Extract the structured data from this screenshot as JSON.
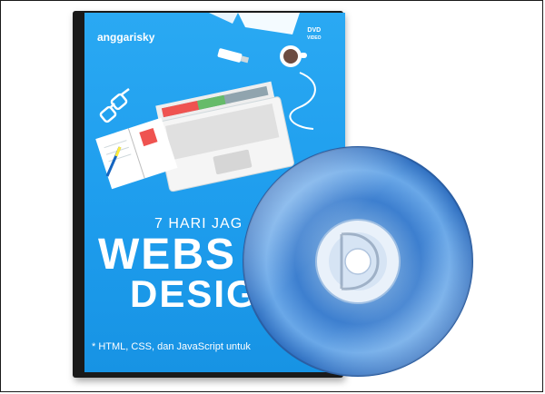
{
  "product": {
    "brand": "anggarisky",
    "dvd_logo_top": "DVD",
    "dvd_logo_bottom": "VIDEO",
    "subtitle": "7 HARI JAG",
    "title_line1": "WEBS",
    "title_line2": "DESIG",
    "tagline": "* HTML, CSS, dan JavaScript untuk",
    "illustration_icons": [
      "laptop-icon",
      "glasses-icon",
      "notebook-icon",
      "pencil-icon",
      "coffee-cup-icon",
      "usb-drive-icon",
      "paper-icon"
    ]
  },
  "colors": {
    "cover_blue": "#1e9ded",
    "disc_blue": "#4a90d9",
    "case_black": "#1a1a1a",
    "text_white": "#ffffff"
  }
}
